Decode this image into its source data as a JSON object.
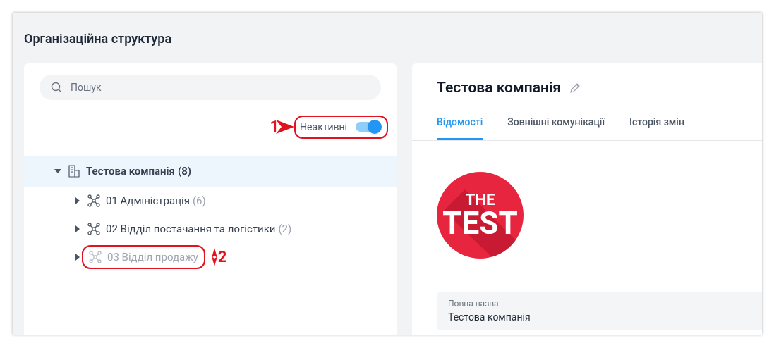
{
  "page": {
    "title": "Організаційна структура"
  },
  "search": {
    "placeholder": "Пошук"
  },
  "inactive_toggle": {
    "label": "Неактивні",
    "on": true,
    "callout": "1"
  },
  "tree": [
    {
      "kind": "company",
      "name": "Тестова компанія",
      "count": "(8)",
      "expanded": true,
      "selected": true,
      "inactive": false,
      "children": [
        {
          "kind": "department",
          "name": "01 Адміністрація",
          "count": "(6)",
          "expanded": false,
          "selected": false,
          "inactive": false
        },
        {
          "kind": "department",
          "name": "02 Відділ постачання та логістики",
          "count": "(2)",
          "expanded": false,
          "selected": false,
          "inactive": false
        },
        {
          "kind": "department",
          "name": "03 Відділ продажу",
          "expanded": false,
          "selected": false,
          "inactive": true,
          "callout": "2"
        }
      ]
    }
  ],
  "details": {
    "title": "Тестова компанія",
    "tabs": [
      {
        "label": "Відомості",
        "selected": true
      },
      {
        "label": "Зовнішні комунікації",
        "selected": false
      },
      {
        "label": "Історія змін",
        "selected": false
      }
    ],
    "logo": {
      "line_1": "THE",
      "line_2": "TEST"
    },
    "fields": [
      {
        "label": "Повна назва",
        "value": "Тестова компанія"
      }
    ]
  }
}
